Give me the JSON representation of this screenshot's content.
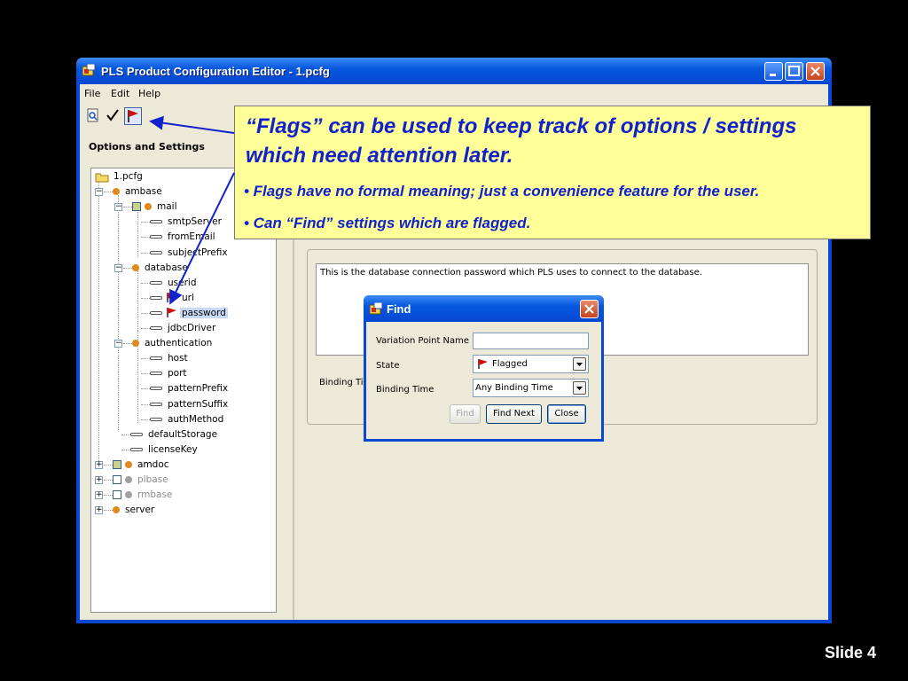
{
  "window": {
    "title": "PLS Product Configuration Editor - 1.pcfg"
  },
  "menu": [
    "File",
    "Edit",
    "Help"
  ],
  "left_panel": {
    "title": "Options and Settings",
    "tree": [
      {
        "label": "1.pcfg",
        "kind": "file"
      },
      {
        "label": "ambase",
        "kind": "group"
      },
      {
        "label": "mail",
        "kind": "group"
      },
      {
        "label": "smtpServer",
        "kind": "setting"
      },
      {
        "label": "fromEmail",
        "kind": "setting"
      },
      {
        "label": "subjectPrefix",
        "kind": "setting"
      },
      {
        "label": "database",
        "kind": "group"
      },
      {
        "label": "userid",
        "kind": "setting"
      },
      {
        "label": "url",
        "kind": "setting",
        "flagged": true
      },
      {
        "label": "password",
        "kind": "setting",
        "flagged": true,
        "selected": true
      },
      {
        "label": "jdbcDriver",
        "kind": "setting"
      },
      {
        "label": "authentication",
        "kind": "group"
      },
      {
        "label": "host",
        "kind": "setting"
      },
      {
        "label": "port",
        "kind": "setting"
      },
      {
        "label": "patternPrefix",
        "kind": "setting"
      },
      {
        "label": "patternSuffix",
        "kind": "setting"
      },
      {
        "label": "authMethod",
        "kind": "setting"
      },
      {
        "label": "defaultStorage",
        "kind": "setting"
      },
      {
        "label": "licenseKey",
        "kind": "setting"
      },
      {
        "label": "amdoc",
        "kind": "group"
      },
      {
        "label": "plbase",
        "kind": "group",
        "disabled": true
      },
      {
        "label": "rmbase",
        "kind": "group",
        "disabled": true
      },
      {
        "label": "server",
        "kind": "group"
      }
    ]
  },
  "detail": {
    "description": "This is the database connection password which PLS uses to connect to the database.",
    "binding_label": "Binding Ti"
  },
  "callout": {
    "headline": "“Flags” can be used to keep track of options / settings which need attention later.",
    "bullet1": "• Flags have no formal meaning; just a convenience feature for the user.",
    "bullet2": "• Can “Find” settings which are flagged."
  },
  "find_dialog": {
    "title": "Find",
    "variation_label": "Variation Point Name",
    "variation_value": "",
    "state_label": "State",
    "state_value": "Flagged",
    "binding_label": "Binding Time",
    "binding_value": "Any Binding Time",
    "find_button": "Find",
    "find_next_button": "Find Next",
    "close_button": "Close"
  },
  "slide_number": "Slide 4",
  "colors": {
    "titlebar": "#0a48d4",
    "callout_bg": "#ffff99",
    "callout_text": "#1122cc",
    "flag": "#d01010",
    "dot": "#e08a1c"
  }
}
